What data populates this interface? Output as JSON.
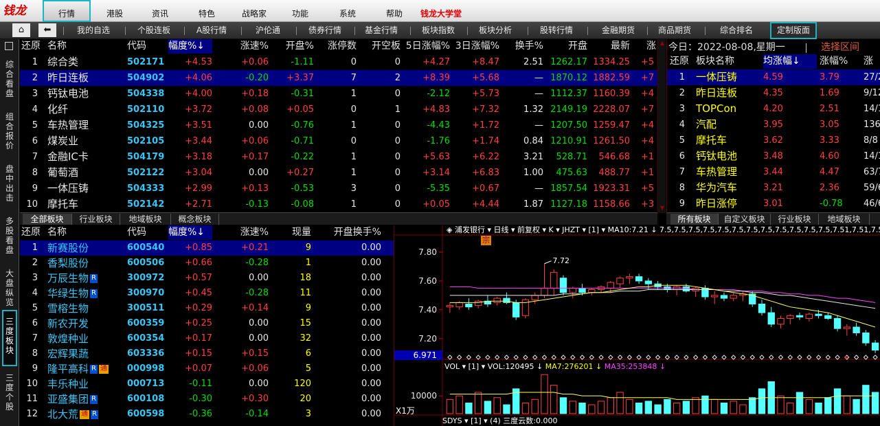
{
  "logo": "钱龙",
  "menu": {
    "items": [
      {
        "label": "行情",
        "active": true
      },
      {
        "label": "港股"
      },
      {
        "label": "资讯"
      },
      {
        "label": "特色"
      },
      {
        "label": "战略家"
      },
      {
        "label": "功能"
      },
      {
        "label": "系统"
      },
      {
        "label": "帮助"
      },
      {
        "label": "钱龙大学堂",
        "red": true
      }
    ]
  },
  "navbar": {
    "items": [
      "我的自选",
      "个股连板",
      "A股行情",
      "沪伦通",
      "债券行情",
      "基金行情",
      "板块指数",
      "板块分析",
      "股转行情",
      "金融期货",
      "商品期货",
      "综合排名",
      "定制版面"
    ],
    "active": "定制版面"
  },
  "lefttabs": [
    "综合看盘",
    "组合报价",
    "盘中出击",
    "多股看盘",
    "大盘纵览",
    "三度板块",
    "三度个股"
  ],
  "lefttabs_active": "三度板块",
  "top_table": {
    "headers": [
      "还原",
      "名称",
      "代码",
      "幅度%↓",
      "涨速%",
      "开盘%",
      "涨停数",
      "开空板",
      "5日涨幅%",
      "3日涨幅%",
      "换手%",
      "开盘",
      "最新",
      "涨"
    ],
    "rows": [
      {
        "n": "1",
        "name": "综合类",
        "code": "502171",
        "chg": "+4.53",
        "spd": "+0.06",
        "open": "-1.11",
        "lim": "0",
        "gap": "0",
        "d5": "+4.27",
        "d3": "+8.47",
        "turn": "2.51",
        "op": "1262.17",
        "last": "1334.25",
        "x": "+5"
      },
      {
        "n": "2",
        "name": "昨日连板",
        "code": "504902",
        "chg": "+4.06",
        "spd": "-0.20",
        "open": "+3.37",
        "lim": "7",
        "gap": "2",
        "d5": "+8.39",
        "d3": "+5.68",
        "turn": "—",
        "op": "1870.12",
        "last": "1882.59",
        "x": "+7",
        "sel": true
      },
      {
        "n": "3",
        "name": "钙钛电池",
        "code": "504338",
        "chg": "+4.00",
        "spd": "+0.18",
        "open": "-0.31",
        "lim": "1",
        "gap": "0",
        "d5": "-2.12",
        "d3": "+5.73",
        "turn": "—",
        "op": "1112.37",
        "last": "1160.39",
        "x": "+4"
      },
      {
        "n": "4",
        "name": "化纤",
        "code": "502110",
        "chg": "+3.72",
        "spd": "+0.08",
        "open": "+0.05",
        "lim": "0",
        "gap": "1",
        "d5": "+4.83",
        "d3": "+7.32",
        "turn": "1.32",
        "op": "2149.19",
        "last": "2228.07",
        "x": "+7"
      },
      {
        "n": "5",
        "name": "车热管理",
        "code": "504325",
        "chg": "+3.51",
        "spd": "0.00",
        "open": "-0.76",
        "lim": "1",
        "gap": "0",
        "d5": "-4.43",
        "d3": "+1.72",
        "turn": "—",
        "op": "1207.50",
        "last": "1259.47",
        "x": "+4"
      },
      {
        "n": "6",
        "name": "煤炭业",
        "code": "502105",
        "chg": "+3.44",
        "spd": "+0.06",
        "open": "-0.71",
        "lim": "0",
        "gap": "0",
        "d5": "-1.76",
        "d3": "+1.74",
        "turn": "0.84",
        "op": "1210.91",
        "last": "1261.50",
        "x": "+4"
      },
      {
        "n": "7",
        "name": "金融IC卡",
        "code": "504179",
        "chg": "+3.18",
        "spd": "+0.17",
        "open": "-0.22",
        "lim": "1",
        "gap": "0",
        "d5": "+5.63",
        "d3": "+6.22",
        "turn": "3.21",
        "op": "528.71",
        "last": "546.68",
        "x": "+1"
      },
      {
        "n": "8",
        "name": "葡萄酒",
        "code": "502122",
        "chg": "+3.04",
        "spd": "0.00",
        "open": "+0.27",
        "lim": "1",
        "gap": "0",
        "d5": "+3.14",
        "d3": "+6.83",
        "turn": "1.00",
        "op": "475.63",
        "last": "488.77",
        "x": "+1"
      },
      {
        "n": "9",
        "name": "一体压铸",
        "code": "504333",
        "chg": "+2.99",
        "spd": "+0.13",
        "open": "-0.53",
        "lim": "3",
        "gap": "0",
        "d5": "-5.35",
        "d3": "+0.67",
        "turn": "—",
        "op": "1857.54",
        "last": "1923.31",
        "x": "+5"
      },
      {
        "n": "10",
        "name": "摩托车",
        "code": "502142",
        "chg": "+2.71",
        "spd": "-0.13",
        "open": "-0.08",
        "lim": "1",
        "gap": "0",
        "d5": "+0.05",
        "d3": "+4.44",
        "turn": "1.87",
        "op": "1127.18",
        "last": "1158.66",
        "x": "+3"
      }
    ]
  },
  "top_tabs": [
    "全部板块",
    "行业板块",
    "地域板块",
    "概念板块"
  ],
  "right_panel": {
    "date_label": "今日：2022-08-08,星期一",
    "select_label": "选择区间",
    "headers": [
      "还原",
      "板块名称",
      "均涨幅↓",
      "涨幅%",
      "涨"
    ],
    "rows": [
      {
        "n": "1",
        "name": "一体压铸",
        "avg": "4.59",
        "chg": "3.79",
        "x": "27/2",
        "sel": true
      },
      {
        "n": "2",
        "name": "昨日连板",
        "avg": "4.35",
        "chg": "1.69",
        "x": "9/12"
      },
      {
        "n": "3",
        "name": "TOPCon",
        "avg": "4.20",
        "chg": "2.51",
        "x": "14/1"
      },
      {
        "n": "4",
        "name": "汽配",
        "avg": "3.95",
        "chg": "3.05",
        "x": "136/"
      },
      {
        "n": "5",
        "name": "摩托车",
        "avg": "3.62",
        "chg": "3.33",
        "x": "8/8"
      },
      {
        "n": "6",
        "name": "钙钛电池",
        "avg": "3.48",
        "chg": "4.60",
        "x": "14/1"
      },
      {
        "n": "7",
        "name": "车热管理",
        "avg": "3.44",
        "chg": "4.47",
        "x": "63/7"
      },
      {
        "n": "8",
        "name": "华为汽车",
        "avg": "3.21",
        "chg": "2.36",
        "x": "59/6"
      },
      {
        "n": "9",
        "name": "昨日涨停",
        "avg": "3.01",
        "chg": "-0.78",
        "x": "46/6"
      }
    ],
    "tabs": [
      "所有板块",
      "自定义板块",
      "行业板块",
      "地域板块"
    ]
  },
  "bottom_table": {
    "headers": [
      "还原",
      "名称",
      "代码",
      "幅度%↓",
      "涨速%",
      "现量",
      "开盘换手%"
    ],
    "rows": [
      {
        "n": "1",
        "name": "新赛股份",
        "code": "600540",
        "chg": "+0.85",
        "spd": "+0.21",
        "vol": "9",
        "turn": "0.00",
        "sel": true
      },
      {
        "n": "2",
        "name": "香梨股份",
        "code": "600506",
        "chg": "+0.66",
        "spd": "-0.28",
        "vol": "1",
        "turn": "0.00"
      },
      {
        "n": "3",
        "name": "万辰生物",
        "code": "300972",
        "chg": "+0.57",
        "spd": "0.00",
        "vol": "18",
        "turn": "0.00",
        "badges": [
          "R"
        ]
      },
      {
        "n": "4",
        "name": "华绿生物",
        "code": "300970",
        "chg": "+0.45",
        "spd": "-0.28",
        "vol": "11",
        "turn": "0.00",
        "badges": [
          "R"
        ]
      },
      {
        "n": "5",
        "name": "雪榕生物",
        "code": "300511",
        "chg": "+0.29",
        "spd": "+0.14",
        "vol": "9",
        "turn": "0.00"
      },
      {
        "n": "6",
        "name": "新农开发",
        "code": "600359",
        "chg": "+0.25",
        "spd": "0.00",
        "vol": "15",
        "turn": "0.00"
      },
      {
        "n": "7",
        "name": "敦煌种业",
        "code": "600354",
        "chg": "+0.17",
        "spd": "0.00",
        "vol": "32",
        "turn": "0.00"
      },
      {
        "n": "8",
        "name": "宏辉果蔬",
        "code": "603336",
        "chg": "+0.15",
        "spd": "+0.15",
        "vol": "6",
        "turn": "0.00"
      },
      {
        "n": "9",
        "name": "隆平高科",
        "code": "000998",
        "chg": "+0.07",
        "spd": "+0.06",
        "vol": "5",
        "turn": "0.00",
        "badges": [
          "R",
          "通"
        ]
      },
      {
        "n": "10",
        "name": "丰乐种业",
        "code": "000713",
        "chg": "-0.11",
        "spd": "0.00",
        "vol": "120",
        "turn": "0.00"
      },
      {
        "n": "11",
        "name": "亚盛集团",
        "code": "600108",
        "chg": "-0.30",
        "spd": "+0.30",
        "vol": "20",
        "turn": "0.00",
        "badges": [
          "R"
        ]
      },
      {
        "n": "12",
        "name": "北大荒",
        "code": "600598",
        "chg": "-0.36",
        "spd": "-0.14",
        "vol": "3",
        "turn": "0.00",
        "badges": [
          "通",
          "R"
        ]
      }
    ]
  },
  "chart": {
    "title_text": "◈ 浦发银行 ▾ 日线 ▾ 前复权 ▾ K ▾ JHZT ▾ [1] ▾ MA10:7.21 ↓",
    "ma30": [
      7.5,
      7.5,
      7.5,
      7.5,
      7.5,
      7.5,
      7.5,
      7.5,
      7.5,
      7.5,
      7.5,
      7.5,
      7.51,
      7.51,
      7.51,
      7.52,
      7.52,
      7.52,
      7.53,
      7.53,
      7.53,
      7.54,
      7.54,
      7.54,
      7.54,
      7.54,
      7.54,
      7.54,
      7.54,
      7.53,
      7.53,
      7.53,
      7.52,
      7.52,
      7.51,
      7.5,
      7.5,
      7.49,
      7.48,
      7.47,
      7.46,
      7.45,
      7.44,
      7.43,
      7.42,
      7.41
    ],
    "ma60": [
      7.56,
      7.56,
      7.56,
      7.55,
      7.55,
      7.55,
      7.55,
      7.55,
      7.55,
      7.55,
      7.55,
      7.55,
      7.55,
      7.55,
      7.55,
      7.55,
      7.55,
      7.55,
      7.55,
      7.55,
      7.55,
      7.55,
      7.55,
      7.55,
      7.55,
      7.55,
      7.54,
      7.54,
      7.54,
      7.54,
      7.54,
      7.53,
      7.53,
      7.53,
      7.52,
      7.52,
      7.51,
      7.51,
      7.5,
      7.5,
      7.49,
      7.48,
      7.48,
      7.47,
      7.46,
      7.45
    ],
    "marker": "宗",
    "price_ticks": [
      "7.80",
      "7.60",
      "7.40",
      "7.20"
    ],
    "price_range": [
      7.08,
      7.9
    ],
    "current_price": "6.971",
    "high_label": "7.72",
    "vol_title": "VOL ▾ [1] ▾ VOL:120495 ↓",
    "vol_ma7": "MA7:276201 ↓",
    "vol_ma35": "MA35:253848 ↓",
    "vol_tick": "10000",
    "vol_unit": "X1万",
    "bottom_label": "SDYS ▾ [1] ▾ (4)  三度云数:0.000",
    "candles": [
      {
        "o": 7.42,
        "h": 7.45,
        "l": 7.38,
        "c": 7.43
      },
      {
        "o": 7.42,
        "h": 7.46,
        "l": 7.4,
        "c": 7.45
      },
      {
        "o": 7.44,
        "h": 7.48,
        "l": 7.4,
        "c": 7.42
      },
      {
        "o": 7.43,
        "h": 7.47,
        "l": 7.41,
        "c": 7.46
      },
      {
        "o": 7.46,
        "h": 7.5,
        "l": 7.42,
        "c": 7.44
      },
      {
        "o": 7.45,
        "h": 7.49,
        "l": 7.43,
        "c": 7.48
      },
      {
        "o": 7.48,
        "h": 7.52,
        "l": 7.44,
        "c": 7.45
      },
      {
        "o": 7.45,
        "h": 7.47,
        "l": 7.33,
        "c": 7.35
      },
      {
        "o": 7.36,
        "h": 7.48,
        "l": 7.34,
        "c": 7.47
      },
      {
        "o": 7.47,
        "h": 7.52,
        "l": 7.44,
        "c": 7.5
      },
      {
        "o": 7.5,
        "h": 7.72,
        "l": 7.48,
        "c": 7.55
      },
      {
        "o": 7.55,
        "h": 7.68,
        "l": 7.5,
        "c": 7.66
      },
      {
        "o": 7.62,
        "h": 7.64,
        "l": 7.5,
        "c": 7.52
      },
      {
        "o": 7.52,
        "h": 7.56,
        "l": 7.48,
        "c": 7.55
      },
      {
        "o": 7.55,
        "h": 7.58,
        "l": 7.5,
        "c": 7.52
      },
      {
        "o": 7.52,
        "h": 7.55,
        "l": 7.5,
        "c": 7.54
      },
      {
        "o": 7.54,
        "h": 7.57,
        "l": 7.52,
        "c": 7.56
      },
      {
        "o": 7.55,
        "h": 7.6,
        "l": 7.52,
        "c": 7.59
      },
      {
        "o": 7.58,
        "h": 7.63,
        "l": 7.55,
        "c": 7.62
      },
      {
        "o": 7.62,
        "h": 7.65,
        "l": 7.58,
        "c": 7.63
      },
      {
        "o": 7.63,
        "h": 7.65,
        "l": 7.58,
        "c": 7.6
      },
      {
        "o": 7.6,
        "h": 7.62,
        "l": 7.54,
        "c": 7.58
      },
      {
        "o": 7.58,
        "h": 7.6,
        "l": 7.54,
        "c": 7.56
      },
      {
        "o": 7.56,
        "h": 7.58,
        "l": 7.52,
        "c": 7.54
      },
      {
        "o": 7.54,
        "h": 7.57,
        "l": 7.5,
        "c": 7.56
      },
      {
        "o": 7.56,
        "h": 7.58,
        "l": 7.52,
        "c": 7.53
      },
      {
        "o": 7.53,
        "h": 7.56,
        "l": 7.49,
        "c": 7.55
      },
      {
        "o": 7.55,
        "h": 7.57,
        "l": 7.47,
        "c": 7.49
      },
      {
        "o": 7.49,
        "h": 7.53,
        "l": 7.44,
        "c": 7.5
      },
      {
        "o": 7.5,
        "h": 7.52,
        "l": 7.46,
        "c": 7.48
      },
      {
        "o": 7.48,
        "h": 7.52,
        "l": 7.46,
        "c": 7.5
      },
      {
        "o": 7.5,
        "h": 7.53,
        "l": 7.46,
        "c": 7.51
      },
      {
        "o": 7.51,
        "h": 7.53,
        "l": 7.42,
        "c": 7.44
      },
      {
        "o": 7.44,
        "h": 7.47,
        "l": 7.36,
        "c": 7.38
      },
      {
        "o": 7.38,
        "h": 7.42,
        "l": 7.28,
        "c": 7.3
      },
      {
        "o": 7.3,
        "h": 7.36,
        "l": 7.27,
        "c": 7.34
      },
      {
        "o": 7.34,
        "h": 7.37,
        "l": 7.3,
        "c": 7.36
      },
      {
        "o": 7.36,
        "h": 7.38,
        "l": 7.33,
        "c": 7.35
      },
      {
        "o": 7.34,
        "h": 7.38,
        "l": 7.32,
        "c": 7.37
      },
      {
        "o": 7.37,
        "h": 7.4,
        "l": 7.34,
        "c": 7.36
      },
      {
        "o": 7.36,
        "h": 7.38,
        "l": 7.33,
        "c": 7.34
      },
      {
        "o": 7.34,
        "h": 7.36,
        "l": 7.25,
        "c": 7.27
      },
      {
        "o": 7.27,
        "h": 7.3,
        "l": 7.22,
        "c": 7.28
      },
      {
        "o": 7.28,
        "h": 7.31,
        "l": 7.22,
        "c": 7.24
      },
      {
        "o": 7.24,
        "h": 7.26,
        "l": 7.15,
        "c": 7.17
      },
      {
        "o": 7.17,
        "h": 7.19,
        "l": 7.1,
        "c": 7.12
      }
    ],
    "ma10": [
      7.45,
      7.45,
      7.45,
      7.45,
      7.46,
      7.46,
      7.46,
      7.45,
      7.45,
      7.46,
      7.47,
      7.48,
      7.49,
      7.5,
      7.51,
      7.52,
      7.52,
      7.53,
      7.54,
      7.55,
      7.56,
      7.56,
      7.57,
      7.57,
      7.57,
      7.57,
      7.56,
      7.55,
      7.54,
      7.53,
      7.52,
      7.51,
      7.5,
      7.48,
      7.46,
      7.44,
      7.42,
      7.41,
      7.4,
      7.39,
      7.38,
      7.36,
      7.34,
      7.32,
      7.3,
      7.28
    ],
    "volumes": [
      8,
      10,
      6,
      12,
      7,
      9,
      5,
      14,
      6,
      8,
      22,
      16,
      9,
      7,
      6,
      5,
      7,
      9,
      12,
      8,
      6,
      7,
      5,
      8,
      6,
      7,
      9,
      10,
      8,
      6,
      7,
      5,
      9,
      14,
      18,
      10,
      6,
      12,
      8,
      6,
      9,
      14,
      10,
      8,
      16,
      12
    ],
    "vol_ma": [
      11,
      11,
      11,
      11,
      11,
      11,
      11,
      12,
      12,
      12,
      12,
      12,
      11,
      11,
      10,
      10,
      10,
      9,
      9,
      9,
      9,
      9,
      9,
      9,
      8,
      8,
      8,
      8,
      8,
      8,
      8,
      8,
      8,
      9,
      9,
      9,
      9,
      9,
      9,
      9,
      9,
      10,
      10,
      10,
      10,
      10
    ],
    "vol_max": 24
  }
}
